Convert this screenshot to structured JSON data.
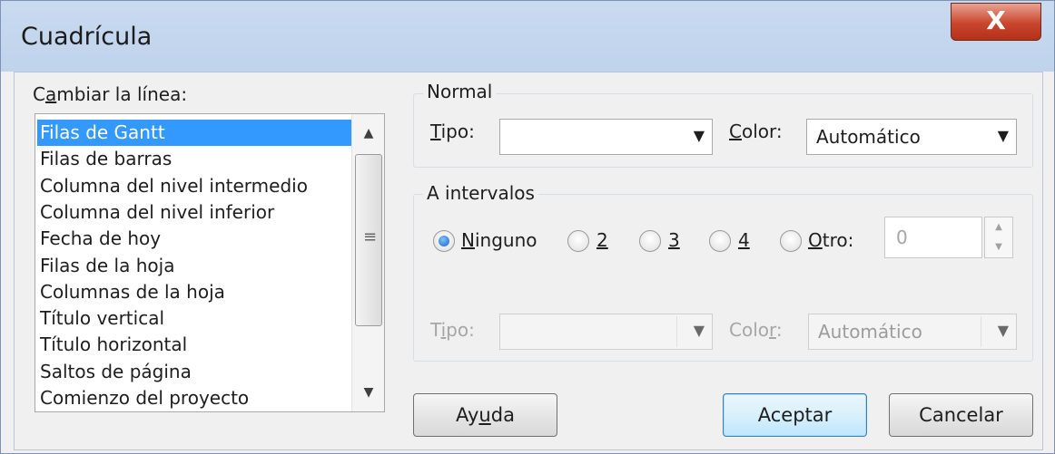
{
  "window": {
    "title": "Cuadrícula",
    "close_glyph": "X"
  },
  "list": {
    "label": "Cambiar la línea:",
    "label_underline": "a",
    "items": [
      "Filas de Gantt",
      "Filas de barras",
      "Columna del nivel intermedio",
      "Columna del nivel inferior",
      "Fecha de hoy",
      "Filas de la hoja",
      "Columnas de la hoja",
      "Título vertical",
      "Título horizontal",
      "Saltos de página",
      "Comienzo del proyecto"
    ],
    "selected_index": 0
  },
  "normal": {
    "group_label": "Normal",
    "tipo_label": "Tipo:",
    "tipo_value": "",
    "color_label": "Color:",
    "color_value": "Automático"
  },
  "intervals": {
    "group_label": "A intervalos",
    "options": [
      "Ninguno",
      "2",
      "3",
      "4",
      "Otro:"
    ],
    "selected": "Ninguno",
    "otro_value": "0",
    "tipo_label": "Tipo:",
    "tipo_value": "",
    "color_label": "Color:",
    "color_value": "Automático"
  },
  "buttons": {
    "help": "Ayuda",
    "ok": "Aceptar",
    "cancel": "Cancelar"
  }
}
